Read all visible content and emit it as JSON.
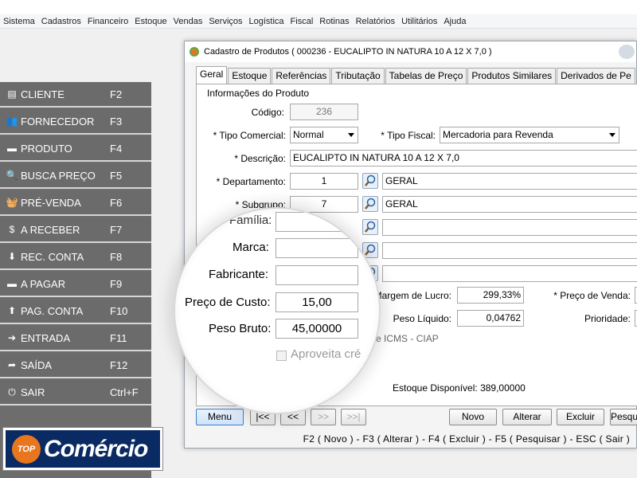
{
  "menu": [
    "Sistema",
    "Cadastros",
    "Financeiro",
    "Estoque",
    "Vendas",
    "Serviços",
    "Logística",
    "Fiscal",
    "Rotinas",
    "Relatórios",
    "Utilitários",
    "Ajuda"
  ],
  "sidebar": {
    "items": [
      {
        "icon": "document-icon",
        "glyph": "▤",
        "label": "CLIENTE",
        "key": "F2"
      },
      {
        "icon": "users-icon",
        "glyph": "👥",
        "label": "FORNECEDOR",
        "key": "F3"
      },
      {
        "icon": "box-icon",
        "glyph": "▬",
        "label": "PRODUTO",
        "key": "F4"
      },
      {
        "icon": "search-icon",
        "glyph": "🔍",
        "label": "BUSCA PREÇO",
        "key": "F5"
      },
      {
        "icon": "basket-icon",
        "glyph": "🧺",
        "label": "PRÉ-VENDA",
        "key": "F6"
      },
      {
        "icon": "dollar-icon",
        "glyph": "$",
        "label": "A RECEBER",
        "key": "F7"
      },
      {
        "icon": "download-icon",
        "glyph": "⬇",
        "label": "REC. CONTA",
        "key": "F8"
      },
      {
        "icon": "card-icon",
        "glyph": "▬",
        "label": "A PAGAR",
        "key": "F9"
      },
      {
        "icon": "upload-icon",
        "glyph": "⬆",
        "label": "PAG. CONTA",
        "key": "F10"
      },
      {
        "icon": "sign-in-icon",
        "glyph": "➔",
        "label": "ENTRADA",
        "key": "F11"
      },
      {
        "icon": "sign-out-icon",
        "glyph": "➦",
        "label": "SAÍDA",
        "key": "F12"
      },
      {
        "icon": "power-icon",
        "glyph": "⏻",
        "label": "SAIR",
        "key": "Ctrl+F"
      }
    ]
  },
  "logo": {
    "badge": "TOP",
    "text": "Comércio"
  },
  "window": {
    "title": "Cadastro de Produtos ( 000236 - EUCALIPTO IN NATURA 10 A 12 X 7,0 )",
    "tabs": [
      "Geral",
      "Estoque",
      "Referências",
      "Tributação",
      "Tabelas de Preço",
      "Produtos Similares",
      "Derivados de Pe"
    ],
    "section_title": "Informações do Produto",
    "labels": {
      "codigo": "Código:",
      "tipo_comercial": "* Tipo Comercial:",
      "tipo_fiscal": "* Tipo Fiscal:",
      "descricao": "* Descrição:",
      "departamento": "* Departamento:",
      "subgrupo": "* Subgrupo:",
      "familia": "Família:",
      "marca": "Marca:",
      "fabricante": "Fabricante:",
      "preco_custo": "Preço de Custo:",
      "peso_bruto": "Peso Bruto:",
      "margem": "Margem de Lucro:",
      "preco_venda": "* Preço de Venda:",
      "peso_liquido": "Peso Líquido:",
      "prioridade": "Prioridade:",
      "icms": "to de ICMS - CIAP",
      "aproveita": "Aproveita cré",
      "estoque": "Estoque Disponível: 389,00000"
    },
    "values": {
      "codigo": "236",
      "tipo_comercial": "Normal",
      "tipo_fiscal": "Mercadoria para Revenda",
      "descricao": "EUCALIPTO IN NATURA 10 A 12 X 7,0",
      "departamento_code": "1",
      "departamento_name": "GERAL",
      "subgrupo_code": "7",
      "subgrupo_name": "GERAL",
      "preco_custo": "15,00",
      "peso_bruto": "45,00000",
      "margem": "299,33%",
      "peso_liquido": "0,04762"
    },
    "buttons": {
      "menu": "Menu",
      "first": "|<<",
      "prev": "<<",
      "next": ">>",
      "last": ">>|",
      "novo": "Novo",
      "alterar": "Alterar",
      "excluir": "Excluir",
      "pesquisar": "Pesqu"
    },
    "statusbar": "F2 ( Novo )  -  F3 ( Alterar )  -  F4 ( Excluir )  -  F5 ( Pesquisar )  -  ESC ( Sair )"
  }
}
